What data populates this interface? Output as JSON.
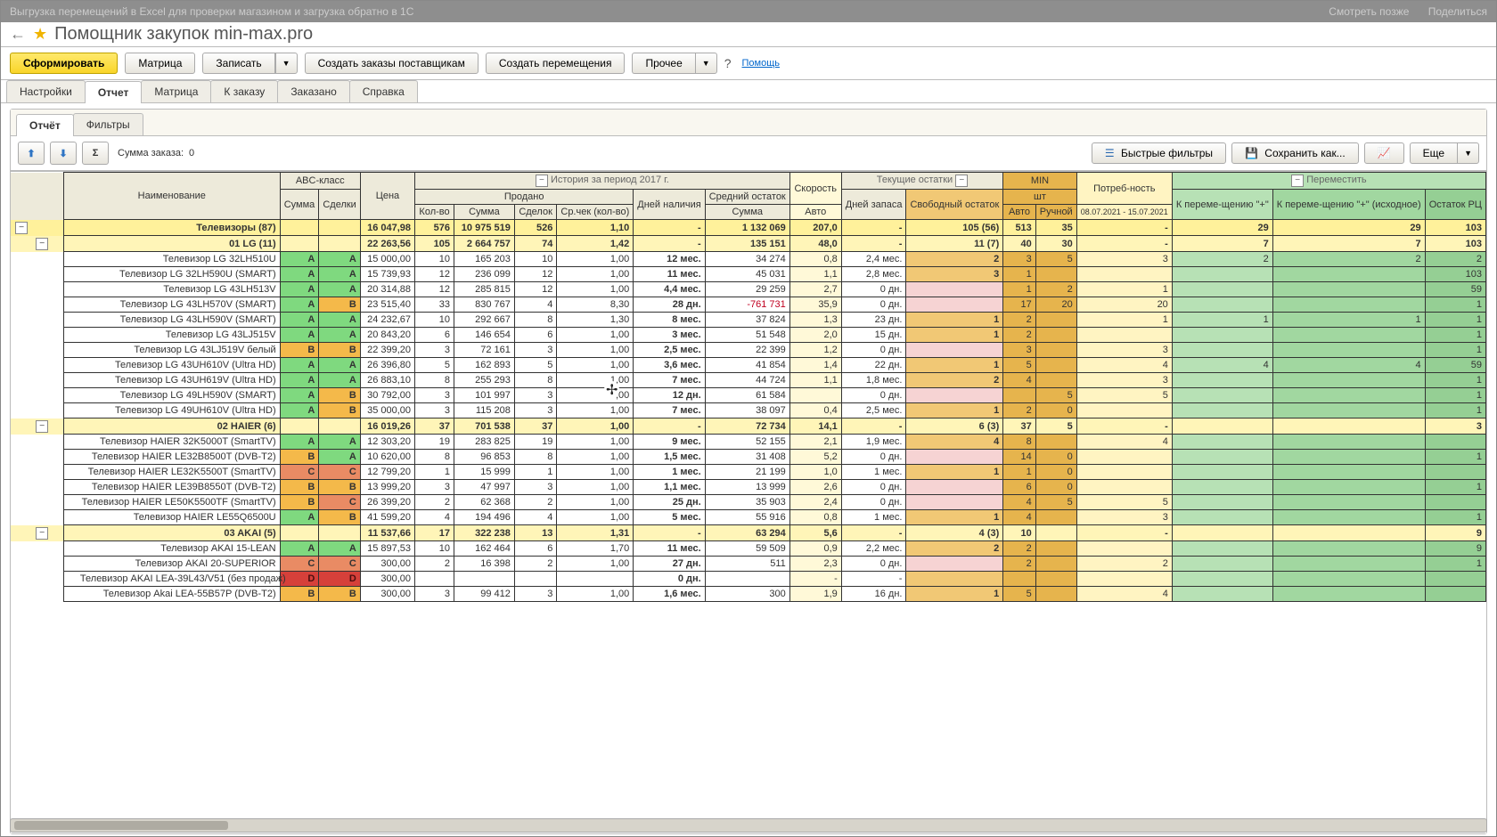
{
  "video_overlay": {
    "crumb": "Выгрузка перемещений в Excel для проверки магазином и загрузка обратно в 1С",
    "later": "Смотреть позже",
    "share": "Поделиться"
  },
  "title": {
    "arrow": "←",
    "star": "★",
    "text": "Помощник закупок min-max.pro"
  },
  "toolbar": {
    "form": "Сформировать",
    "matrix": "Матрица",
    "write": "Записать",
    "write_drop": "▼",
    "supplier": "Создать заказы поставщикам",
    "move": "Создать перемещения",
    "other": "Прочее",
    "other_drop": "▼",
    "help_q": "?",
    "help": "Помощь"
  },
  "tabs": {
    "settings": "Настройки",
    "report": "Отчет",
    "matrix": "Матрица",
    "toorder": "К заказу",
    "ordered": "Заказано",
    "help": "Справка"
  },
  "tabs2": {
    "report": "Отчёт",
    "filters": "Фильтры"
  },
  "toolbar2": {
    "up": "⬆",
    "down": "⬇",
    "sigma": "Σ",
    "sum_label": "Сумма заказа:",
    "sum_val": "0",
    "fast": "Быстрые фильтры",
    "save": "Сохранить как...",
    "chart": "📈",
    "more": "Еще",
    "more_drop": "▼"
  },
  "headers": {
    "name": "Наименование",
    "abc": "ABC-класс",
    "abc_sum": "Сумма",
    "abc_deal": "Сделки",
    "price": "Цена",
    "hist": "История за период 2017 г.",
    "sold": "Продано",
    "kol": "Кол-во",
    "sum": "Сумма",
    "deals": "Сделок",
    "avgchk": "Ср.чек (кол-во)",
    "days": "Дней наличия",
    "avgrem": "Средний остаток",
    "avgrem_sum": "Сумма",
    "speed": "Скорость",
    "auto": "Авто",
    "cur": "Текущие остатки",
    "cur_days": "Дней запаса",
    "free": "Свободный остаток",
    "min": "MIN",
    "min_unit": "шт",
    "min_auto": "Авто",
    "min_man": "Ручной",
    "need": "Потреб-ность",
    "need_dates": "08.07.2021 - 15.07.2021",
    "move": "Переместить",
    "m1": "К переме-щению \"+\"",
    "m2": "К переме-щению \"+\" (исходное)",
    "m3": "Остаток РЦ"
  },
  "rows": [
    {
      "type": "cat",
      "name": "Телевизоры (87)",
      "price": "16 047,98",
      "kol": "576",
      "sum": "10 975 519",
      "deals": "526",
      "avgchk": "1,10",
      "days": "",
      "avgsum": "1 132 069",
      "speed": "207,0",
      "cdays": "",
      "free": "105 (56)",
      "mina": "513",
      "minm": "35",
      "need": "-",
      "m1": "29",
      "m2": "29",
      "m3": "103"
    },
    {
      "type": "brand",
      "name": "01 LG (11)",
      "price": "22 263,56",
      "kol": "105",
      "sum": "2 664 757",
      "deals": "74",
      "avgchk": "1,42",
      "days": "",
      "avgsum": "135 151",
      "speed": "48,0",
      "cdays": "",
      "free": "11 (7)",
      "mina": "40",
      "minm": "30",
      "need": "-",
      "m1": "7",
      "m2": "7",
      "m3": "103"
    },
    {
      "type": "item",
      "name": "Телевизор LG 32LH510U",
      "a1": "A",
      "a2": "A",
      "price": "15 000,00",
      "kol": "10",
      "sum": "165 203",
      "deals": "10",
      "avgchk": "1,00",
      "days": "12 мес.",
      "avgsum": "34 274",
      "speed": "0,8",
      "cdays": "2,4 мес.",
      "free": "2",
      "mina": "3",
      "minm": "5",
      "need": "3",
      "m1": "2",
      "m2": "2",
      "m3": "2"
    },
    {
      "type": "item",
      "name": "Телевизор LG 32LH590U (SMART)",
      "a1": "A",
      "a2": "A",
      "price": "15 739,93",
      "kol": "12",
      "sum": "236 099",
      "deals": "12",
      "avgchk": "1,00",
      "days": "11 мес.",
      "avgsum": "45 031",
      "speed": "1,1",
      "cdays": "2,8 мес.",
      "free": "3",
      "mina": "1",
      "minm": "",
      "need": "",
      "m1": "",
      "m2": "",
      "m3": "103"
    },
    {
      "type": "item",
      "name": "Телевизор LG 43LH513V",
      "a1": "A",
      "a2": "A",
      "price": "20 314,88",
      "kol": "12",
      "sum": "285 815",
      "deals": "12",
      "avgchk": "1,00",
      "days": "4,4 мес.",
      "avgsum": "29 259",
      "speed": "2,7",
      "cdays": "0 дн.",
      "free": "",
      "free_pink": true,
      "mina": "1",
      "minm": "2",
      "need": "1",
      "m1": "",
      "m2": "",
      "m3": "59"
    },
    {
      "type": "item",
      "name": "Телевизор LG 43LH570V (SMART)",
      "a1": "A",
      "a2": "B",
      "price": "23 515,40",
      "kol": "33",
      "sum": "830 767",
      "deals": "4",
      "avgchk": "8,30",
      "days": "28 дн.",
      "avgsum": "-761 731",
      "avg_neg": true,
      "speed": "35,9",
      "cdays": "0 дн.",
      "free": "",
      "free_pink": true,
      "mina": "17",
      "minm": "20",
      "need": "20",
      "m1": "",
      "m2": "",
      "m3": "1"
    },
    {
      "type": "item",
      "name": "Телевизор LG 43LH590V (SMART)",
      "a1": "A",
      "a2": "A",
      "price": "24 232,67",
      "kol": "10",
      "sum": "292 667",
      "deals": "8",
      "avgchk": "1,30",
      "days": "8 мес.",
      "avgsum": "37 824",
      "speed": "1,3",
      "cdays": "23 дн.",
      "free": "1",
      "mina": "2",
      "minm": "",
      "need": "1",
      "m1": "1",
      "m2": "1",
      "m3": "1"
    },
    {
      "type": "item",
      "name": "Телевизор LG 43LJ515V",
      "a1": "A",
      "a2": "A",
      "price": "20 843,20",
      "kol": "6",
      "sum": "146 654",
      "deals": "6",
      "avgchk": "1,00",
      "days": "3 мес.",
      "avgsum": "51 548",
      "speed": "2,0",
      "cdays": "15 дн.",
      "free": "1",
      "mina": "2",
      "minm": "",
      "need": "",
      "m1": "",
      "m2": "",
      "m3": "1"
    },
    {
      "type": "item",
      "name": "Телевизор LG 43LJ519V белый",
      "a1": "B",
      "a2": "B",
      "price": "22 399,20",
      "kol": "3",
      "sum": "72 161",
      "deals": "3",
      "avgchk": "1,00",
      "days": "2,5 мес.",
      "avgsum": "22 399",
      "speed": "1,2",
      "cdays": "0 дн.",
      "free": "",
      "free_pink": true,
      "mina": "3",
      "minm": "",
      "need": "3",
      "m1": "",
      "m2": "",
      "m3": "1"
    },
    {
      "type": "item",
      "name": "Телевизор LG 43UH610V (Ultra HD)",
      "a1": "A",
      "a2": "A",
      "price": "26 396,80",
      "kol": "5",
      "sum": "162 893",
      "deals": "5",
      "avgchk": "1,00",
      "days": "3,6 мес.",
      "avgsum": "41 854",
      "speed": "1,4",
      "cdays": "22 дн.",
      "free": "1",
      "mina": "5",
      "minm": "",
      "need": "4",
      "m1": "4",
      "m2": "4",
      "m3": "59"
    },
    {
      "type": "item",
      "name": "Телевизор LG 43UH619V (Ultra HD)",
      "a1": "A",
      "a2": "A",
      "price": "26 883,10",
      "kol": "8",
      "sum": "255 293",
      "deals": "8",
      "avgchk": "1,00",
      "days": "7 мес.",
      "avgsum": "44 724",
      "speed": "1,1",
      "cdays": "1,8 мес.",
      "free": "2",
      "mina": "4",
      "minm": "",
      "need": "3",
      "m1": "",
      "m2": "",
      "m3": "1"
    },
    {
      "type": "item",
      "name": "Телевизор LG 49LH590V (SMART)",
      "a1": "A",
      "a2": "B",
      "price": "30 792,00",
      "kol": "3",
      "sum": "101 997",
      "deals": "3",
      "avgchk": "1,00",
      "days": "12 дн.",
      "avgsum": "61 584",
      "speed": "",
      "cdays": "0 дн.",
      "free": "",
      "free_pink": true,
      "mina": "",
      "minm": "5",
      "need": "5",
      "m1": "",
      "m2": "",
      "m3": "1"
    },
    {
      "type": "item",
      "name": "Телевизор LG 49UH610V (Ultra HD)",
      "a1": "A",
      "a2": "B",
      "price": "35 000,00",
      "kol": "3",
      "sum": "115 208",
      "deals": "3",
      "avgchk": "1,00",
      "days": "7 мес.",
      "avgsum": "38 097",
      "speed": "0,4",
      "cdays": "2,5 мес.",
      "free": "1",
      "mina": "2",
      "minm": "0",
      "need": "",
      "m1": "",
      "m2": "",
      "m3": "1"
    },
    {
      "type": "brand",
      "name": "02 HAIER (6)",
      "price": "16 019,26",
      "kol": "37",
      "sum": "701 538",
      "deals": "37",
      "avgchk": "1,00",
      "days": "",
      "avgsum": "72 734",
      "speed": "14,1",
      "cdays": "",
      "free": "6 (3)",
      "mina": "37",
      "minm": "5",
      "need": "-",
      "m1": "",
      "m2": "",
      "m3": "3"
    },
    {
      "type": "item",
      "name": "Телевизор HAIER 32K5000T (SmartTV)",
      "a1": "A",
      "a2": "A",
      "price": "12 303,20",
      "kol": "19",
      "sum": "283 825",
      "deals": "19",
      "avgchk": "1,00",
      "days": "9 мес.",
      "avgsum": "52 155",
      "speed": "2,1",
      "cdays": "1,9 мес.",
      "free": "4",
      "mina": "8",
      "minm": "",
      "need": "4",
      "m1": "",
      "m2": "",
      "m3": ""
    },
    {
      "type": "item",
      "name": "Телевизор HAIER LE32B8500T (DVB-T2)",
      "a1": "B",
      "a2": "A",
      "price": "10 620,00",
      "kol": "8",
      "sum": "96 853",
      "deals": "8",
      "avgchk": "1,00",
      "days": "1,5 мес.",
      "avgsum": "31 408",
      "speed": "5,2",
      "cdays": "0 дн.",
      "free": "",
      "free_pink": true,
      "mina": "14",
      "minm": "0",
      "need": "",
      "m1": "",
      "m2": "",
      "m3": "1"
    },
    {
      "type": "item",
      "name": "Телевизор HAIER LE32K5500T (SmartTV)",
      "a1": "C",
      "a2": "C",
      "price": "12 799,20",
      "kol": "1",
      "sum": "15 999",
      "deals": "1",
      "avgchk": "1,00",
      "days": "1 мес.",
      "avgsum": "21 199",
      "speed": "1,0",
      "cdays": "1 мес.",
      "free": "1",
      "mina": "1",
      "minm": "0",
      "need": "",
      "m1": "",
      "m2": "",
      "m3": ""
    },
    {
      "type": "item",
      "name": "Телевизор HAIER LE39B8550T (DVB-T2)",
      "a1": "B",
      "a2": "B",
      "price": "13 999,20",
      "kol": "3",
      "sum": "47 997",
      "deals": "3",
      "avgchk": "1,00",
      "days": "1,1 мес.",
      "avgsum": "13 999",
      "speed": "2,6",
      "cdays": "0 дн.",
      "free": "",
      "free_pink": true,
      "mina": "6",
      "minm": "0",
      "need": "",
      "m1": "",
      "m2": "",
      "m3": "1"
    },
    {
      "type": "item",
      "name": "Телевизор HAIER LE50K5500TF (SmartTV)",
      "a1": "B",
      "a2": "C",
      "price": "26 399,20",
      "kol": "2",
      "sum": "62 368",
      "deals": "2",
      "avgchk": "1,00",
      "days": "25 дн.",
      "avgsum": "35 903",
      "speed": "2,4",
      "cdays": "0 дн.",
      "free": "",
      "free_pink": true,
      "mina": "4",
      "minm": "5",
      "need": "5",
      "m1": "",
      "m2": "",
      "m3": ""
    },
    {
      "type": "item",
      "name": "Телевизор HAIER LE55Q6500U",
      "a1": "A",
      "a2": "B",
      "price": "41 599,20",
      "kol": "4",
      "sum": "194 496",
      "deals": "4",
      "avgchk": "1,00",
      "days": "5 мес.",
      "avgsum": "55 916",
      "speed": "0,8",
      "cdays": "1 мес.",
      "free": "1",
      "mina": "4",
      "minm": "",
      "need": "3",
      "m1": "",
      "m2": "",
      "m3": "1"
    },
    {
      "type": "brand",
      "name": "03 AKAI (5)",
      "price": "11 537,66",
      "kol": "17",
      "sum": "322 238",
      "deals": "13",
      "avgchk": "1,31",
      "days": "",
      "avgsum": "63 294",
      "speed": "5,6",
      "cdays": "",
      "free": "4 (3)",
      "mina": "10",
      "minm": "",
      "need": "-",
      "m1": "",
      "m2": "",
      "m3": "9"
    },
    {
      "type": "item",
      "name": "Телевизор AKAI 15-LEAN",
      "a1": "A",
      "a2": "A",
      "price": "15 897,53",
      "kol": "10",
      "sum": "162 464",
      "deals": "6",
      "avgchk": "1,70",
      "days": "11 мес.",
      "avgsum": "59 509",
      "speed": "0,9",
      "cdays": "2,2 мес.",
      "free": "2",
      "mina": "2",
      "minm": "",
      "need": "",
      "m1": "",
      "m2": "",
      "m3": "9"
    },
    {
      "type": "item",
      "name": "Телевизор AKAI 20-SUPERIOR",
      "a1": "C",
      "a2": "C",
      "price": "300,00",
      "kol": "2",
      "sum": "16 398",
      "deals": "2",
      "avgchk": "1,00",
      "days": "27 дн.",
      "avgsum": "511",
      "speed": "2,3",
      "cdays": "0 дн.",
      "free": "",
      "free_pink": true,
      "mina": "2",
      "minm": "",
      "need": "2",
      "m1": "",
      "m2": "",
      "m3": "1"
    },
    {
      "type": "item",
      "name": "Телевизор AKAI LEA-39L43/V51 (без продаж)",
      "a1": "D",
      "a2": "D",
      "price": "300,00",
      "kol": "",
      "sum": "",
      "deals": "",
      "avgchk": "",
      "days": "0 дн.",
      "avgsum": "",
      "speed": "-",
      "cdays": "",
      "free": "",
      "mina": "",
      "minm": "",
      "need": "",
      "m1": "",
      "m2": "",
      "m3": ""
    },
    {
      "type": "item",
      "name": "Телевизор Akai LEA-55B57P (DVB-T2)",
      "a1": "B",
      "a2": "B",
      "price": "300,00",
      "kol": "3",
      "sum": "99 412",
      "deals": "3",
      "avgchk": "1,00",
      "days": "1,6 мес.",
      "avgsum": "300",
      "speed": "1,9",
      "cdays": "16 дн.",
      "free": "1",
      "mina": "5",
      "minm": "",
      "need": "4",
      "m1": "",
      "m2": "",
      "m3": ""
    }
  ]
}
